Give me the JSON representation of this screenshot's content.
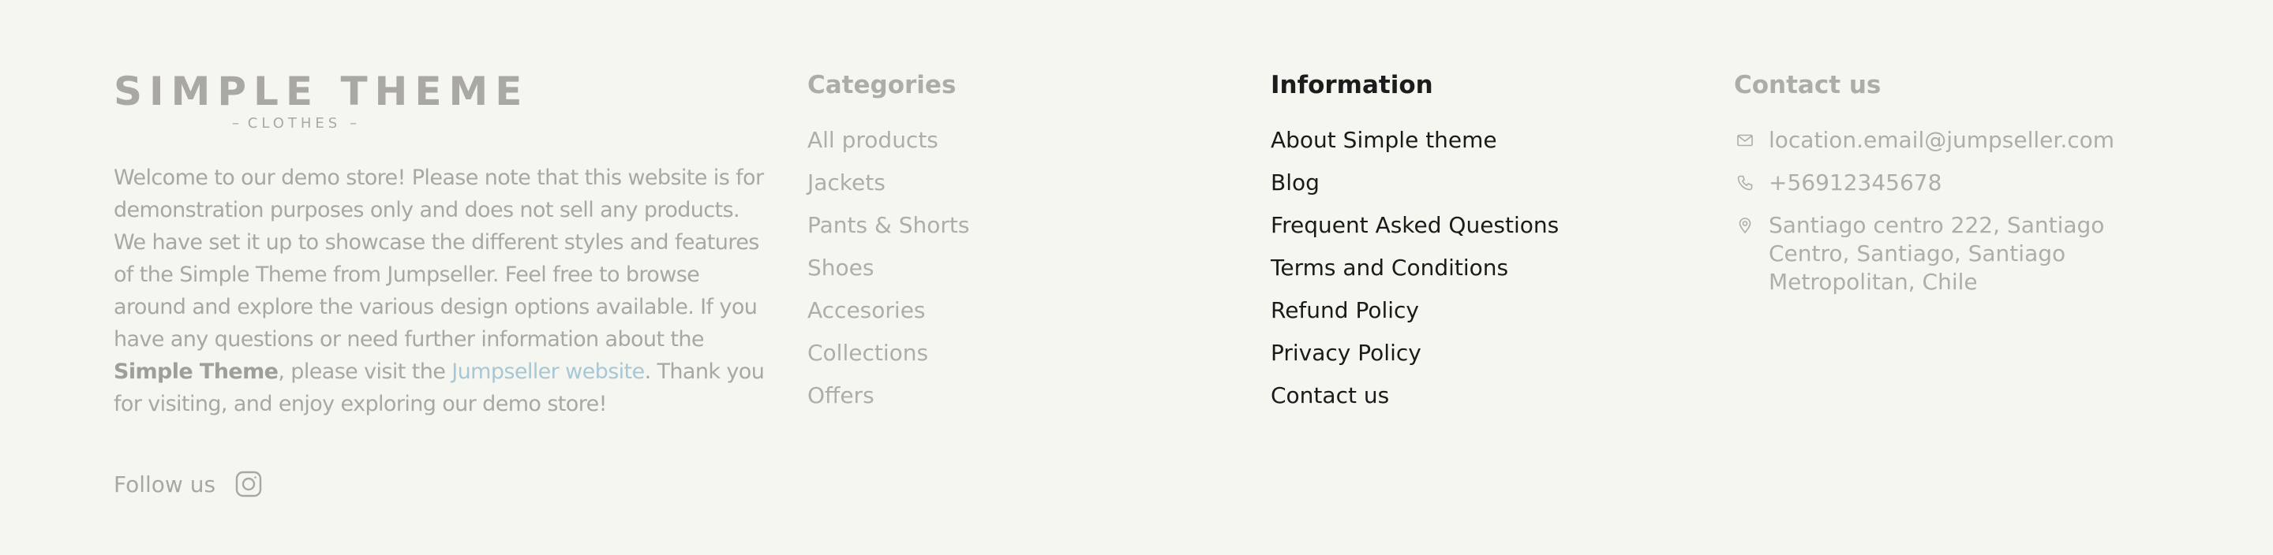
{
  "brand": {
    "logo_title": "SIMPLE THEME",
    "logo_subtitle": "CLOTHES",
    "about_part1": "Welcome to our demo store! Please note that this website is for demonstration purposes only and does not sell any products. We have set it up to showcase the different styles and features of the Simple Theme from Jumpseller. Feel free to browse around and explore the various design options available. If you have any questions or need further information about the ",
    "about_bold": "Simple Theme",
    "about_part2": ", please visit the ",
    "about_link": "Jumpseller website",
    "about_part3": ". Thank you for visiting, and enjoy exploring our demo store!",
    "follow_label": "Follow us",
    "social_icon": "instagram-icon"
  },
  "categories": {
    "title": "Categories",
    "items": [
      "All products",
      "Jackets",
      "Pants & Shorts",
      "Shoes",
      "Accesories",
      "Collections",
      "Offers"
    ]
  },
  "information": {
    "title": "Information",
    "items": [
      "About Simple theme",
      "Blog",
      "Frequent Asked Questions",
      "Terms and Conditions",
      "Refund Policy",
      "Privacy Policy",
      "Contact us"
    ]
  },
  "contact": {
    "title": "Contact us",
    "email": "location.email@jumpseller.com",
    "phone": "+56912345678",
    "address": "Santiago centro 222, Santiago Centro, Santiago, Santiago Metropolitan, Chile"
  },
  "colors": {
    "background": "#f6f6f1",
    "muted_text": "#a8a7a2",
    "dark_text": "#1a1a1a",
    "link_accent": "#a8c6d4"
  }
}
